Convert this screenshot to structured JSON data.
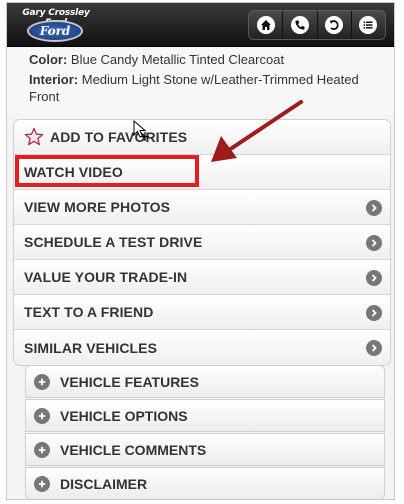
{
  "header": {
    "logo_text": "Gary Crossley Ford",
    "logo_badge": "Ford",
    "nav_icons": [
      "home-icon",
      "phone-icon",
      "back-icon",
      "menu-icon"
    ]
  },
  "details": {
    "color_label": "Color:",
    "color_value": "Blue Candy Metallic Tinted Clearcoat",
    "interior_label": "Interior:",
    "interior_value": "Medium Light Stone w/Leather-Trimmed Heated Front"
  },
  "actions": {
    "favorites": "ADD TO FAVORITES",
    "watch_video": "WATCH VIDEO",
    "more_photos": "VIEW MORE PHOTOS",
    "test_drive": "SCHEDULE A TEST DRIVE",
    "trade_in": "VALUE YOUR TRADE-IN",
    "text_friend": "TEXT TO A FRIEND",
    "similar": "SIMILAR VEHICLES"
  },
  "sections": {
    "features": "VEHICLE FEATURES",
    "options": "VEHICLE OPTIONS",
    "comments": "VEHICLE COMMENTS",
    "disclaimer": "DISCLAIMER"
  },
  "colors": {
    "highlight": "#e51f1f",
    "annotation_arrow": "#a01b1b",
    "header_bg": "#111111",
    "ford_blue": "#13357a"
  }
}
